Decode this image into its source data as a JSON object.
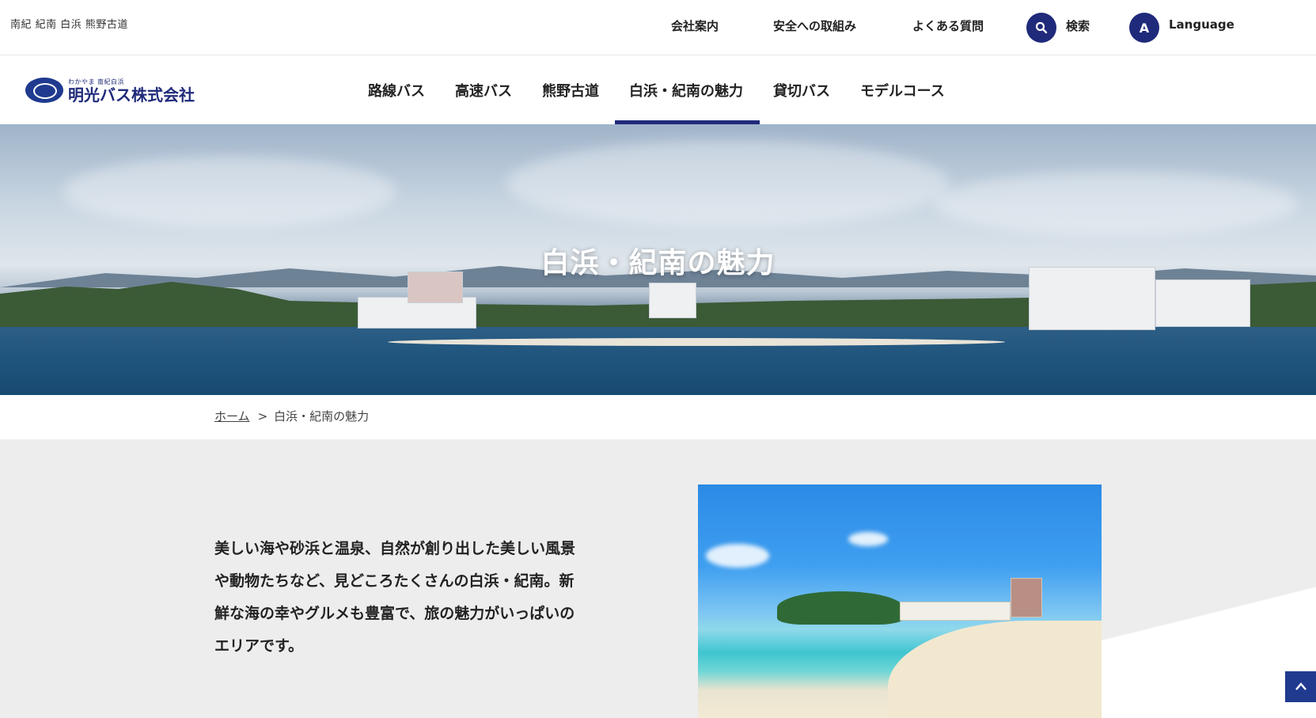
{
  "topbar": {
    "tagline": "南紀 紀南 白浜 熊野古道",
    "links": [
      {
        "label": "会社案内"
      },
      {
        "label": "安全への取組み"
      },
      {
        "label": "よくある質問"
      }
    ],
    "search": {
      "icon": "search-icon",
      "label": "検索"
    },
    "language": {
      "badge": "A",
      "label": "Language"
    }
  },
  "header": {
    "logo": {
      "small": "わかやま 南紀白浜",
      "name": "明光バス株式会社"
    },
    "nav": [
      {
        "label": "路線バス"
      },
      {
        "label": "高速バス"
      },
      {
        "label": "熊野古道"
      },
      {
        "label": "白浜・紀南の魅力",
        "active": true
      },
      {
        "label": "貸切バス"
      },
      {
        "label": "モデルコース"
      }
    ]
  },
  "hero": {
    "title": "白浜・紀南の魅力"
  },
  "breadcrumb": {
    "home": "ホーム",
    "separator": ">",
    "current": "白浜・紀南の魅力"
  },
  "intro": {
    "text": "美しい海や砂浜と温泉、自然が創り出した美しい風景や動物たちなど、見どころたくさんの白浜・紀南。新鮮な海の幸やグルメも豊富で、旅の魅力がいっぱいのエリアです。"
  },
  "colors": {
    "accent": "#1f2a7a",
    "panel": "#ededed"
  },
  "back_to_top": {
    "icon": "chevron-up-icon"
  }
}
